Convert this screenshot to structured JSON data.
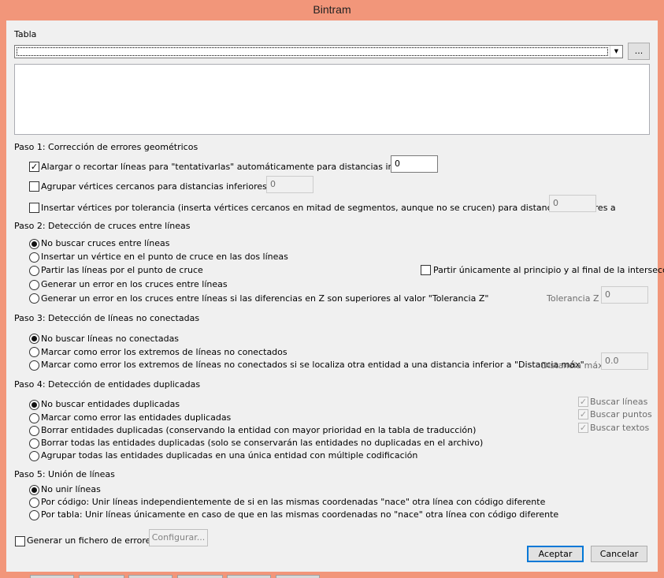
{
  "window": {
    "title": "Bintram"
  },
  "tabla": {
    "label": "Tabla",
    "combo_value": "",
    "browse_label": "..."
  },
  "step1": {
    "title": "Paso 1: Corrección de errores geométricos",
    "options": [
      {
        "label": "Alargar o recortar líneas para \"tentativarlas\" automáticamente para distancias inferiores a",
        "checked": true,
        "value": "0"
      },
      {
        "label": "Agrupar vértices cercanos para distancias inferiores a",
        "checked": false,
        "value": "0"
      },
      {
        "label": "Insertar vértices por tolerancia (inserta vértices cercanos en mitad de segmentos, aunque no se crucen) para distancias inferiores a",
        "checked": false,
        "value": "0"
      }
    ]
  },
  "step2": {
    "title": "Paso 2: Detección de cruces entre líneas",
    "options": [
      "No buscar cruces entre líneas",
      "Insertar un vértice en el punto de cruce en las dos líneas",
      "Partir las líneas por el punto de cruce",
      "Generar un error en los cruces entre líneas",
      "Generar un error en los cruces entre líneas si las diferencias en Z son superiores al valor \"Tolerancia Z\""
    ],
    "selected": 0,
    "partir_label": "Partir únicamente al principio y al final de la intersección",
    "tolerancia_label": "Tolerancia Z",
    "tolerancia_value": "0"
  },
  "step3": {
    "title": "Paso 3: Detección de líneas no conectadas",
    "options": [
      "No buscar líneas no conectadas",
      "Marcar como error los extremos de líneas no conectados",
      "Marcar como error los extremos de líneas no conectados si se localiza otra entidad a una distancia inferior a \"Distancia máx\""
    ],
    "selected": 0,
    "distancia_label": "Distancia máx",
    "distancia_value": "0.0"
  },
  "step4": {
    "title": "Paso 4: Detección de entidades duplicadas",
    "options": [
      "No buscar entidades duplicadas",
      "Marcar como error las entidades duplicadas",
      "Borrar entidades duplicadas (conservando la entidad con mayor prioridad en la tabla de traducción)",
      "Borrar todas las entidades duplicadas (solo se conservarán las entidades no duplicadas en el archivo)",
      "Agrupar todas las entidades duplicadas en una única entidad con múltiple codificación"
    ],
    "selected": 0,
    "search": [
      "Buscar líneas",
      "Buscar puntos",
      "Buscar textos"
    ]
  },
  "step5": {
    "title": "Paso 5: Unión de líneas",
    "options": [
      "No unir líneas",
      "Por código: Unir líneas independientemente de si en las mismas coordenadas \"nace\" otra línea con código diferente",
      "Por tabla: Unir líneas únicamente en caso de que en las mismas coordenadas no \"nace\" otra línea con código diferente"
    ],
    "selected": 0
  },
  "footer": {
    "generar_label": "Generar un fichero de errores",
    "configurar_label": "Configurar...",
    "aceptar_label": "Aceptar",
    "cancelar_label": "Cancelar"
  }
}
